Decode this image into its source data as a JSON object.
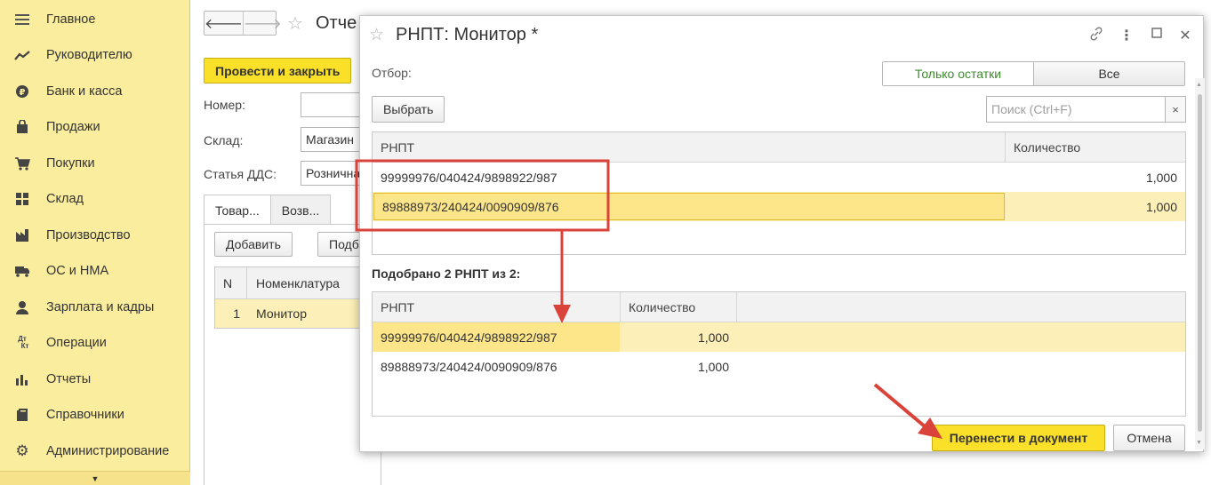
{
  "sidebar": {
    "items": [
      {
        "label": "Главное",
        "icon": "menu-icon"
      },
      {
        "label": "Руководителю",
        "icon": "trend-icon"
      },
      {
        "label": "Банк и касса",
        "icon": "ruble-coin-icon"
      },
      {
        "label": "Продажи",
        "icon": "shopping-bag-icon"
      },
      {
        "label": "Покупки",
        "icon": "cart-icon"
      },
      {
        "label": "Склад",
        "icon": "warehouse-icon"
      },
      {
        "label": "Производство",
        "icon": "factory-icon"
      },
      {
        "label": "ОС и НМА",
        "icon": "truck-icon"
      },
      {
        "label": "Зарплата и кадры",
        "icon": "person-icon"
      },
      {
        "label": "Операции",
        "icon": "debit-credit-icon"
      },
      {
        "label": "Отчеты",
        "icon": "bar-chart-icon"
      },
      {
        "label": "Справочники",
        "icon": "book-icon"
      },
      {
        "label": "Администрирование",
        "icon": "gear-icon"
      }
    ]
  },
  "document": {
    "title": "Отче",
    "post_close_label": "Провести и закрыть",
    "fields": {
      "number_label": "Номер:",
      "number_value": "",
      "warehouse_label": "Склад:",
      "warehouse_value": "Магазин",
      "cashflow_label": "Статья ДДС:",
      "cashflow_value": "Рознична"
    },
    "tabs": [
      "Товар...",
      "Возв..."
    ],
    "add_label": "Добавить",
    "pick_label": "Подб",
    "table": {
      "headers": [
        "N",
        "Номенклатура"
      ],
      "rows": [
        {
          "n": "1",
          "name": "Монитор"
        }
      ]
    }
  },
  "dialog": {
    "title": "РНПТ: Монитор *",
    "filter_label": "Отбор:",
    "toggle": {
      "only_balances": "Только остатки",
      "all": "Все"
    },
    "select_label": "Выбрать",
    "search_placeholder": "Поиск (Ctrl+F)",
    "clear_symbol": "×",
    "top_grid": {
      "headers": [
        "РНПТ",
        "Количество"
      ],
      "rows": [
        {
          "rnpt": "99999976/040424/9898922/987",
          "qty": "1,000"
        },
        {
          "rnpt": "89888973/240424/0090909/876",
          "qty": "1,000"
        }
      ]
    },
    "picked_label": "Подобрано 2 РНПТ из 2:",
    "bottom_grid": {
      "headers": [
        "РНПТ",
        "Количество"
      ],
      "rows": [
        {
          "rnpt": "99999976/040424/9898922/987",
          "qty": "1,000"
        },
        {
          "rnpt": "89888973/240424/0090909/876",
          "qty": "1,000"
        }
      ]
    },
    "transfer_label": "Перенести в документ",
    "cancel_label": "Отмена"
  },
  "colors": {
    "sidebar_bg": "#fbed9e",
    "accent_yellow": "#fbe02a",
    "selected_row": "#fde68a",
    "annotation_red": "#d9433a",
    "toggle_active_text": "#3e8a2f"
  }
}
